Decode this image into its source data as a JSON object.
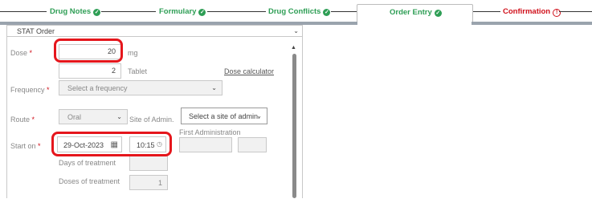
{
  "stepper": {
    "steps": [
      {
        "label": "Drug Notes",
        "status": "done"
      },
      {
        "label": "Formulary",
        "status": "done"
      },
      {
        "label": "Drug Conflicts",
        "status": "done"
      },
      {
        "label": "Order Entry",
        "status": "done",
        "active": true
      },
      {
        "label": "Confirmation",
        "status": "error"
      }
    ]
  },
  "form": {
    "order_type": "STAT Order",
    "dose": {
      "label": "Dose",
      "value": "20",
      "unit": "mg",
      "sub_value": "2",
      "sub_unit": "Tablet",
      "calculator_link": "Dose calculator"
    },
    "frequency": {
      "label": "Frequency",
      "placeholder": "Select a frequency"
    },
    "route": {
      "label": "Route",
      "value": "Oral",
      "site_label": "Site of Admin.",
      "site_placeholder": "Select a site of admin."
    },
    "start": {
      "label": "Start on",
      "date": "29-Oct-2023",
      "time": "10:15",
      "first_admin_label": "First Administration"
    },
    "days_label": "Days of treatment",
    "doses_label": "Doses of treatment",
    "doses_value": "1"
  },
  "colors": {
    "done": "#2e9e55",
    "error": "#d0101b",
    "highlight": "#e5161c"
  }
}
